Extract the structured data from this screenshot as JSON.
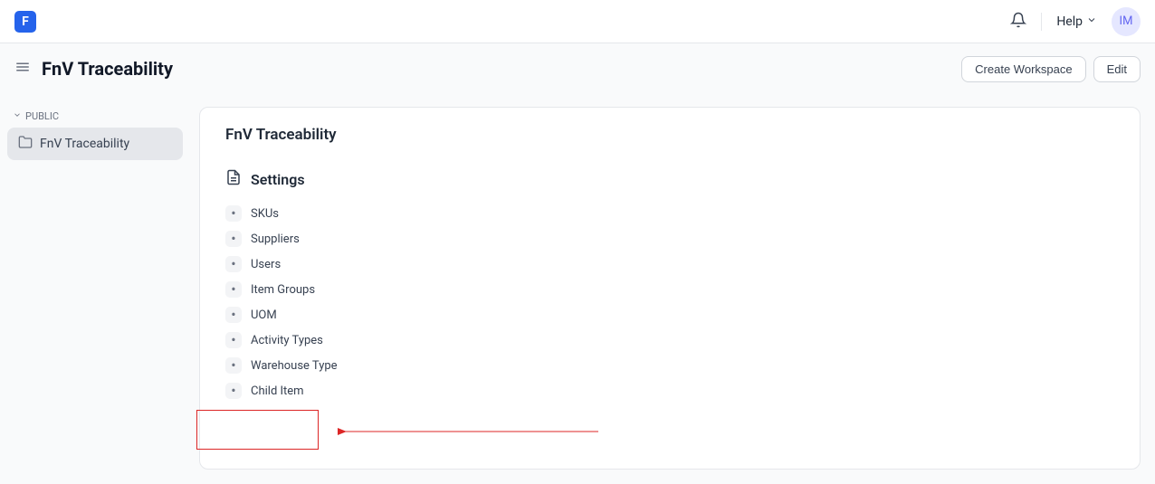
{
  "header": {
    "logo_text": "F",
    "help_label": "Help",
    "avatar_initials": "IM"
  },
  "page": {
    "title": "FnV Traceability",
    "create_workspace_label": "Create Workspace",
    "edit_label": "Edit"
  },
  "sidebar": {
    "group_label": "PUBLIC",
    "items": [
      {
        "label": "FnV Traceability",
        "active": true
      }
    ]
  },
  "card": {
    "title": "FnV Traceability",
    "section_title": "Settings",
    "settings_items": [
      {
        "label": "SKUs"
      },
      {
        "label": "Suppliers"
      },
      {
        "label": "Users"
      },
      {
        "label": "Item Groups"
      },
      {
        "label": "UOM"
      },
      {
        "label": "Activity Types"
      },
      {
        "label": "Warehouse Type"
      },
      {
        "label": "Child Item"
      }
    ]
  }
}
